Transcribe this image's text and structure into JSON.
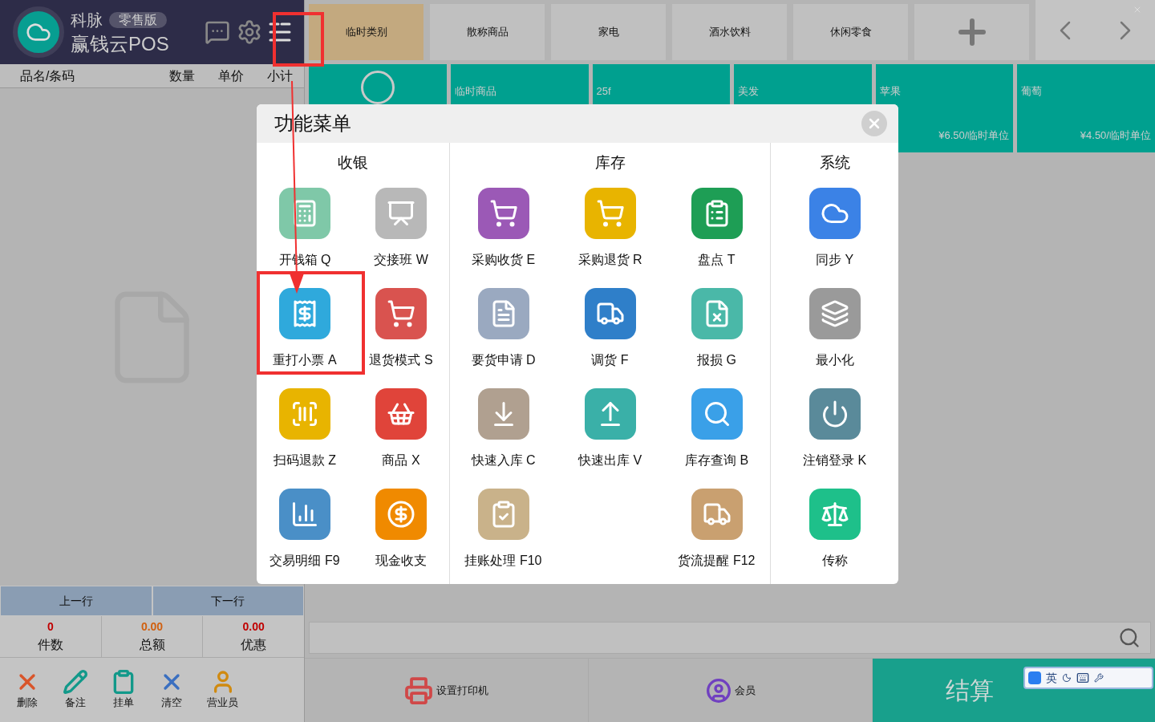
{
  "header": {
    "brand": "科脉",
    "edition": "零售版",
    "product": "赢钱云POS"
  },
  "cart": {
    "columns": [
      "品名/条码",
      "数量",
      "单价",
      "小计"
    ]
  },
  "nav_buttons": [
    "上一行",
    "下一行"
  ],
  "totals": [
    {
      "value": "0",
      "label": "件数",
      "kind": "count"
    },
    {
      "value": "0.00",
      "label": "总额",
      "kind": "amount"
    },
    {
      "value": "0.00",
      "label": "优惠",
      "kind": "discount"
    }
  ],
  "actions": [
    "删除",
    "备注",
    "挂单",
    "清空",
    "营业员"
  ],
  "categories": [
    {
      "label": "临时类别",
      "selected": true
    },
    {
      "label": "散称商品",
      "selected": false
    },
    {
      "label": "家电",
      "selected": false
    },
    {
      "label": "酒水饮料",
      "selected": false
    },
    {
      "label": "休闲零食",
      "selected": false
    }
  ],
  "products": [
    {
      "name": "临时商品"
    },
    {
      "name": "25f"
    },
    {
      "name": "美发"
    },
    {
      "name": "苹果",
      "price": "¥6.50/临时单位"
    },
    {
      "name": "葡萄",
      "price": "¥4.50/临时单位"
    }
  ],
  "bottom_buttons": [
    {
      "label": "设置打印机",
      "kind": "printer"
    },
    {
      "label": "会员",
      "kind": "member"
    },
    {
      "label": "结算",
      "kind": "checkout"
    }
  ],
  "ime_toolbar": {
    "mode": "英"
  },
  "menu": {
    "title": "功能菜单",
    "sections": [
      {
        "title": "收银",
        "rows": [
          [
            "开钱箱 Q",
            "交接班 W"
          ],
          [
            "重打小票 A",
            "退货模式 S"
          ],
          [
            "扫码退款 Z",
            "商品 X"
          ],
          [
            "交易明细 F9",
            "现金收支"
          ]
        ]
      },
      {
        "title": "库存",
        "rows": [
          [
            "采购收货 E",
            "采购退货 R",
            "盘点 T"
          ],
          [
            "要货申请 D",
            "调货 F",
            "报损 G"
          ],
          [
            "快速入库 C",
            "快速出库 V",
            "库存查询 B"
          ],
          [
            "挂账处理 F10",
            null,
            "货流提醒 F12"
          ]
        ]
      },
      {
        "title": "系统",
        "rows": [
          [
            "同步 Y"
          ],
          [
            "最小化"
          ],
          [
            "注销登录 K"
          ],
          [
            "传称"
          ]
        ]
      }
    ]
  }
}
